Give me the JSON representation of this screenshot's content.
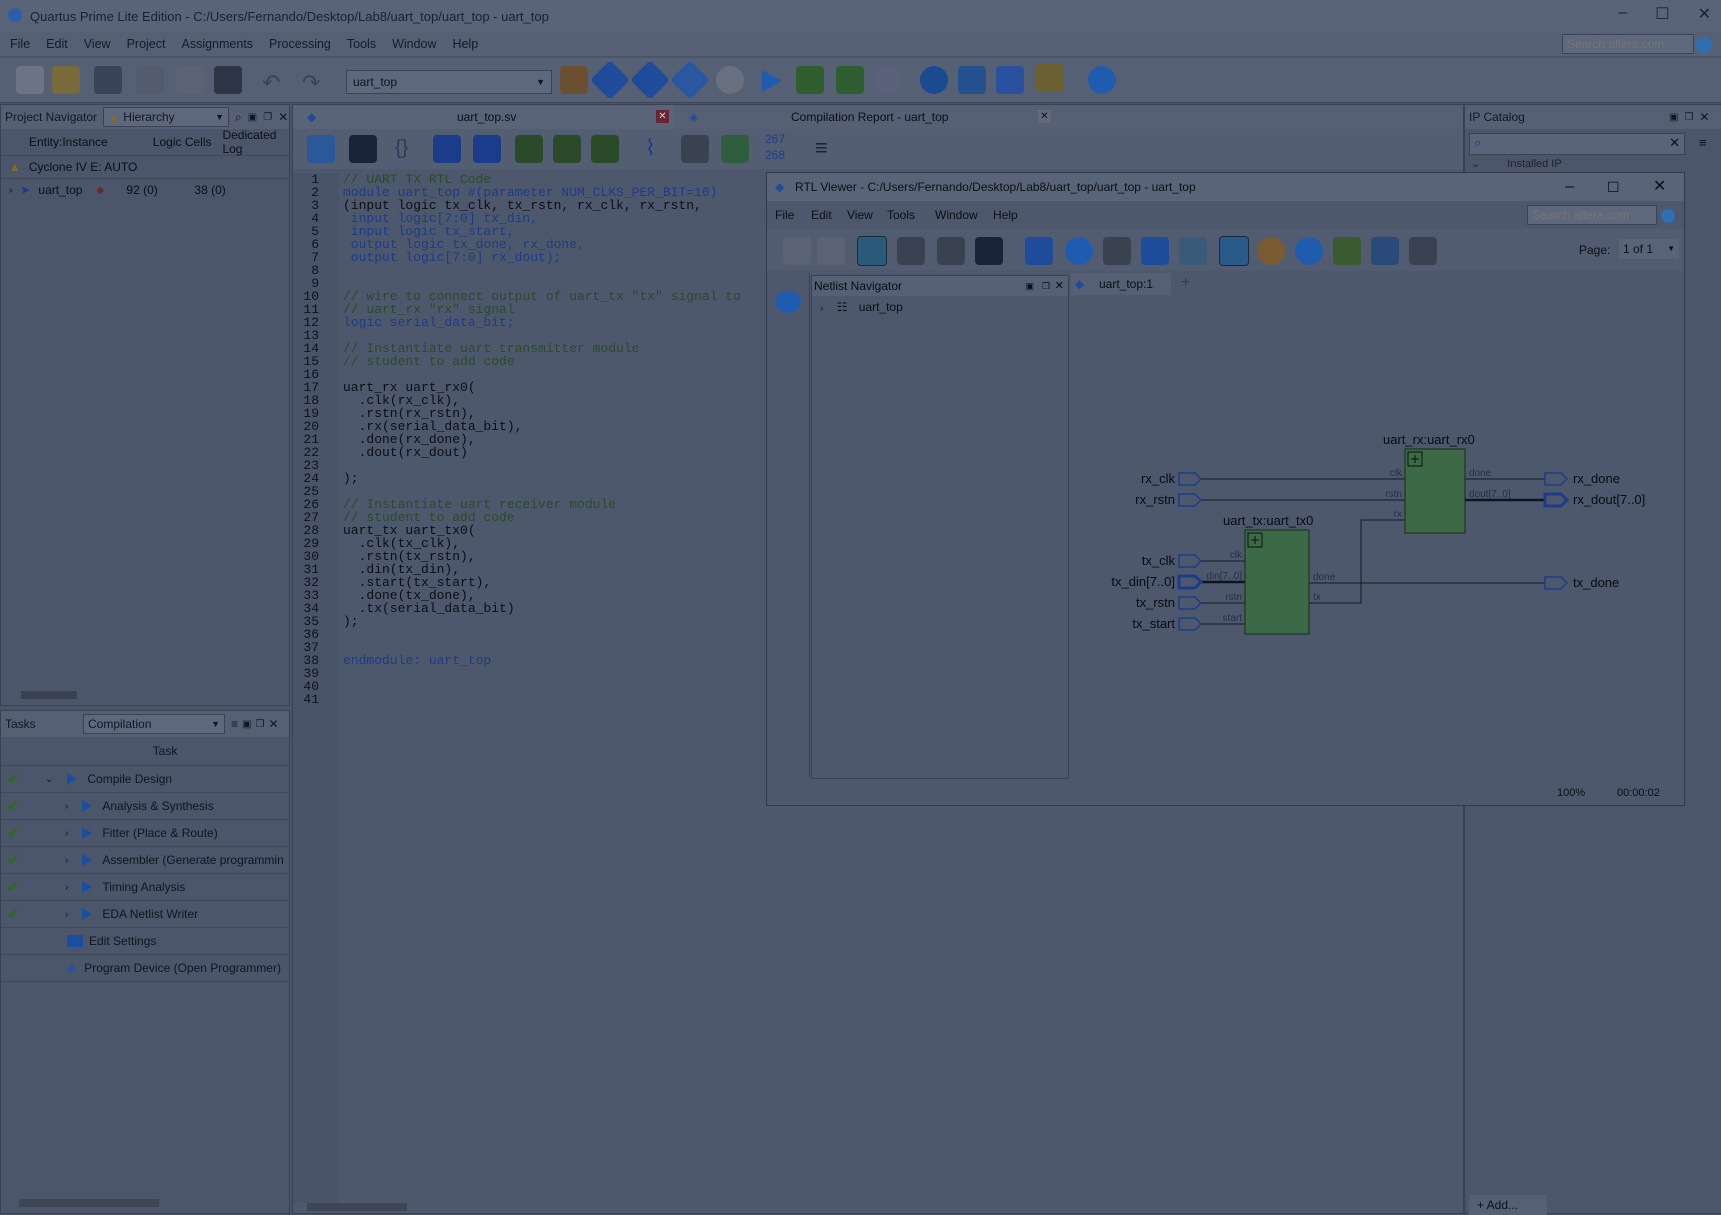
{
  "app": {
    "title": "Quartus Prime Lite Edition - C:/Users/Fernando/Desktop/Lab8/uart_top/uart_top - uart_top",
    "menu": [
      "File",
      "Edit",
      "View",
      "Project",
      "Assignments",
      "Processing",
      "Tools",
      "Window",
      "Help"
    ],
    "search_placeholder": "Search altera.com",
    "entity_select": "uart_top"
  },
  "project_navigator": {
    "label": "Project Navigator",
    "view": "Hierarchy",
    "columns": [
      "Entity:Instance",
      "Logic Cells",
      "Dedicated Log"
    ],
    "device": "Cyclone IV E: AUTO",
    "rows": [
      {
        "name": "uart_top",
        "logic_cells": "92 (0)",
        "dedicated": "38 (0)"
      }
    ]
  },
  "tasks": {
    "label": "Tasks",
    "flow": "Compilation",
    "header": "Task",
    "items": [
      {
        "label": "Compile Design",
        "done": true
      },
      {
        "label": "Analysis & Synthesis",
        "done": true
      },
      {
        "label": "Fitter (Place & Route)",
        "done": true
      },
      {
        "label": "Assembler (Generate programmin",
        "done": true
      },
      {
        "label": "Timing Analysis",
        "done": true
      },
      {
        "label": "EDA Netlist Writer",
        "done": true
      },
      {
        "label": "Edit Settings",
        "done": false
      },
      {
        "label": "Program Device (Open Programmer)",
        "done": false
      }
    ]
  },
  "editor": {
    "tab1": "uart_top.sv",
    "tab2": "Compilation Report - uart_top",
    "line_a": "267",
    "line_b": "268",
    "code_lines": [
      "// UART TX RTL Code",
      "module uart_top #(parameter NUM_CLKS_PER_BIT=16)",
      "(input logic tx_clk, tx_rstn, rx_clk, rx_rstn,",
      " input logic[7:0] tx_din,",
      " input logic tx_start,",
      " output logic tx_done, rx_done,",
      " output logic[7:0] rx_dout);",
      "",
      "",
      "// wire to connect output of uart_tx \"tx\" signal to",
      "// uart_rx \"rx\" signal",
      "logic serial_data_bit;",
      "",
      "// Instantiate uart transmitter module",
      "// student to add code",
      "",
      "uart_rx uart_rx0(",
      "  .clk(rx_clk),",
      "  .rstn(rx_rstn),",
      "  .rx(serial_data_bit),",
      "  .done(rx_done),",
      "  .dout(rx_dout)",
      "",
      ");",
      "",
      "// Instantiate uart receiver module",
      "// student to add code",
      "uart_tx uart_tx0(",
      "  .clk(tx_clk),",
      "  .rstn(tx_rstn),",
      "  .din(tx_din),",
      "  .start(tx_start),",
      "  .done(tx_done),",
      "  .tx(serial_data_bit)",
      ");",
      "",
      "",
      "endmodule: uart_top",
      "",
      "",
      ""
    ]
  },
  "ip_catalog": {
    "label": "IP Catalog",
    "installed": "Installed IP",
    "add": "+ Add..."
  },
  "rtl_viewer": {
    "title": "RTL Viewer - C:/Users/Fernando/Desktop/Lab8/uart_top/uart_top - uart_top",
    "menu": [
      "File",
      "Edit",
      "View",
      "Tools",
      "Window",
      "Help"
    ],
    "search_placeholder": "Search altera.com",
    "page_label": "Page:",
    "page_value": "1 of 1",
    "netlist_label": "Netlist Navigator",
    "netlist_root": "uart_top",
    "tab": "uart_top:1",
    "zoom": "100%",
    "time": "00:00:02",
    "schematic": {
      "rx_block": "uart_rx:uart_rx0",
      "tx_block": "uart_tx:uart_tx0",
      "inputs": [
        "rx_clk",
        "rx_rstn",
        "tx_clk",
        "tx_din[7..0]",
        "tx_rstn",
        "tx_start"
      ],
      "outputs": [
        "rx_done",
        "rx_dout[7..0]",
        "tx_done"
      ],
      "rx_pins": [
        "clk",
        "rstn",
        "rx",
        "done",
        "dout[7..0]"
      ],
      "tx_pins": [
        "clk",
        "din[7..0]",
        "rstn",
        "start",
        "done",
        "tx"
      ]
    }
  }
}
